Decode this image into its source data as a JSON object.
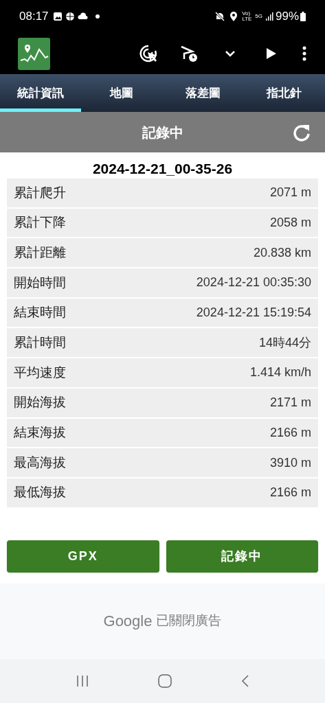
{
  "status_bar": {
    "time": "08:17",
    "network_labels": [
      "Vo)",
      "LTE",
      "5G"
    ],
    "battery": "99%"
  },
  "tabs": [
    {
      "label": "統計資訊",
      "selected": true
    },
    {
      "label": "地圖",
      "selected": false
    },
    {
      "label": "落差圖",
      "selected": false
    },
    {
      "label": "指北針",
      "selected": false
    }
  ],
  "header": {
    "title": "記錄中"
  },
  "track_name": "2024-12-21_00-35-26",
  "stats": [
    {
      "label": "累計爬升",
      "value": "2071 m"
    },
    {
      "label": "累計下降",
      "value": "2058 m"
    },
    {
      "label": "累計距離",
      "value": "20.838 km"
    },
    {
      "label": "開始時間",
      "value": "2024-12-21 00:35:30"
    },
    {
      "label": "結束時間",
      "value": "2024-12-21 15:19:54"
    },
    {
      "label": "累計時間",
      "value": "14時44分"
    },
    {
      "label": "平均速度",
      "value": "1.414 km/h"
    },
    {
      "label": "開始海拔",
      "value": "2171 m"
    },
    {
      "label": "結束海拔",
      "value": "2166 m"
    },
    {
      "label": "最高海拔",
      "value": "3910 m"
    },
    {
      "label": "最低海拔",
      "value": "2166 m"
    }
  ],
  "buttons": [
    "GPX",
    "記錄中"
  ],
  "ad": {
    "brand": "Google",
    "message": "已關閉廣告"
  }
}
